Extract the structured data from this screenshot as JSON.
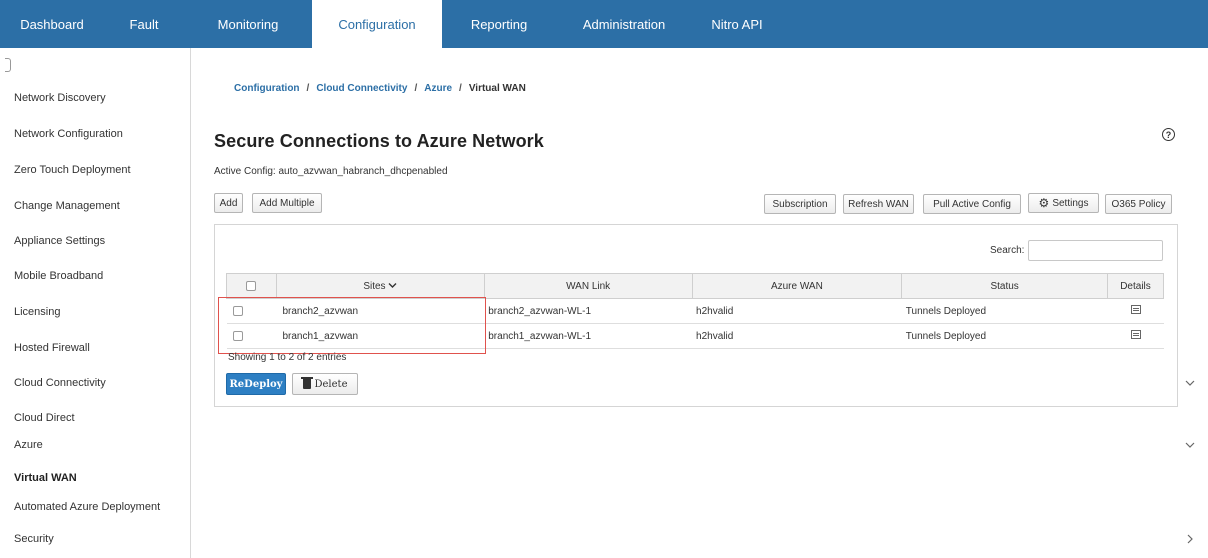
{
  "topnav": {
    "tabs": [
      {
        "label": "Dashboard"
      },
      {
        "label": "Fault"
      },
      {
        "label": "Monitoring"
      },
      {
        "label": "Configuration"
      },
      {
        "label": "Reporting"
      },
      {
        "label": "Administration"
      },
      {
        "label": "Nitro API"
      }
    ],
    "active": "Configuration"
  },
  "sidebar": {
    "items": [
      {
        "label": "Network Discovery"
      },
      {
        "label": "Network Configuration"
      },
      {
        "label": "Zero Touch Deployment"
      },
      {
        "label": "Change Management"
      },
      {
        "label": "Appliance Settings"
      },
      {
        "label": "Mobile Broadband"
      },
      {
        "label": "Licensing"
      },
      {
        "label": "Hosted Firewall"
      },
      {
        "label": "Cloud Connectivity"
      },
      {
        "label": "Cloud Direct"
      },
      {
        "label": "Azure"
      },
      {
        "label": "Virtual WAN"
      },
      {
        "label": "Automated Azure Deployment"
      },
      {
        "label": "Security"
      }
    ]
  },
  "breadcrumb": {
    "items": [
      "Configuration",
      "Cloud Connectivity",
      "Azure",
      "Virtual WAN"
    ],
    "separator": "/"
  },
  "page": {
    "title": "Secure Connections to Azure Network",
    "active_config": "Active Config: auto_azvwan_habranch_dhcpenabled",
    "help_icon": "?"
  },
  "toolbar": {
    "add": "Add",
    "add_multiple": "Add Multiple",
    "subscription": "Subscription",
    "refresh_wan": "Refresh WAN",
    "pull_active_config": "Pull Active Config",
    "settings": "Settings",
    "o365_policy": "O365 Policy"
  },
  "table": {
    "search_label": "Search:",
    "search_value": "",
    "columns": [
      "Sites",
      "WAN Link",
      "Azure WAN",
      "Status",
      "Details"
    ],
    "rows": [
      {
        "site": "branch2_azvwan",
        "wan_link": "branch2_azvwan-WL-1",
        "azure_wan": "h2hvalid",
        "status": "Tunnels Deployed"
      },
      {
        "site": "branch1_azvwan",
        "wan_link": "branch1_azvwan-WL-1",
        "azure_wan": "h2hvalid",
        "status": "Tunnels Deployed"
      }
    ],
    "showing": "Showing 1 to 2 of 2 entries"
  },
  "actions": {
    "redeploy": "ReDeploy",
    "delete": "Delete"
  },
  "colors": {
    "nav_bg": "#2c6fa6",
    "status_warning": "#f39c12",
    "primary_button": "#2d7fc3",
    "highlight_border": "#e0524d"
  }
}
